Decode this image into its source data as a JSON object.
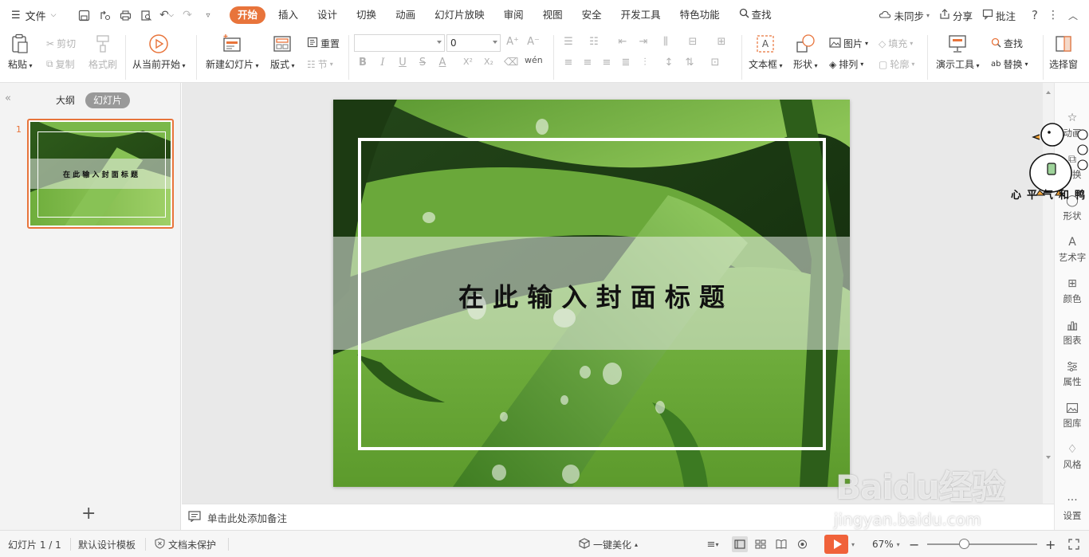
{
  "menubar": {
    "file_label": "文件",
    "tabs": [
      "开始",
      "插入",
      "设计",
      "切换",
      "动画",
      "幻灯片放映",
      "审阅",
      "视图",
      "安全",
      "开发工具",
      "特色功能"
    ],
    "active_tab": "开始",
    "search_label": "查找",
    "sync_label": "未同步",
    "share_label": "分享",
    "comment_label": "批注",
    "help_label": "?"
  },
  "ribbon": {
    "paste": "粘贴",
    "cut": "剪切",
    "copy": "复制",
    "format_painter": "格式刷",
    "from_current": "从当前开始",
    "new_slide": "新建幻灯片",
    "layout": "版式",
    "reset": "重置",
    "section": "节",
    "font_name": "",
    "font_size": "0",
    "text_box": "文本框",
    "shape": "形状",
    "picture": "图片",
    "fill": "填充",
    "arrange": "排列",
    "outline": "轮廓",
    "present_tools": "演示工具",
    "find": "查找",
    "replace": "替换",
    "select_pane": "选择窗"
  },
  "left_panel": {
    "outline_tab": "大纲",
    "slides_tab": "幻灯片",
    "slide_number": "1"
  },
  "slide": {
    "title": "在 此 输 入 封 面 标 题",
    "thumb_title": "在 此 输 入 封 面 标 题"
  },
  "right_panel": {
    "items": [
      "动画",
      "切换",
      "形状",
      "艺术字",
      "颜色",
      "图表",
      "属性",
      "图库",
      "风格",
      "设置"
    ]
  },
  "sticker": {
    "caption": "心平气和鸭"
  },
  "notes": {
    "placeholder": "单击此处添加备注"
  },
  "status": {
    "slide_counter": "幻灯片 1 / 1",
    "template": "默认设计模板",
    "protect": "文档未保护",
    "beautify": "一键美化",
    "zoom": "67%",
    "zoom_level": 0.33
  },
  "watermark": {
    "logo": "Baidu经验",
    "url": "jingyan.baidu.com"
  },
  "colors": {
    "accent": "#e8743b",
    "play": "#f0623a"
  }
}
